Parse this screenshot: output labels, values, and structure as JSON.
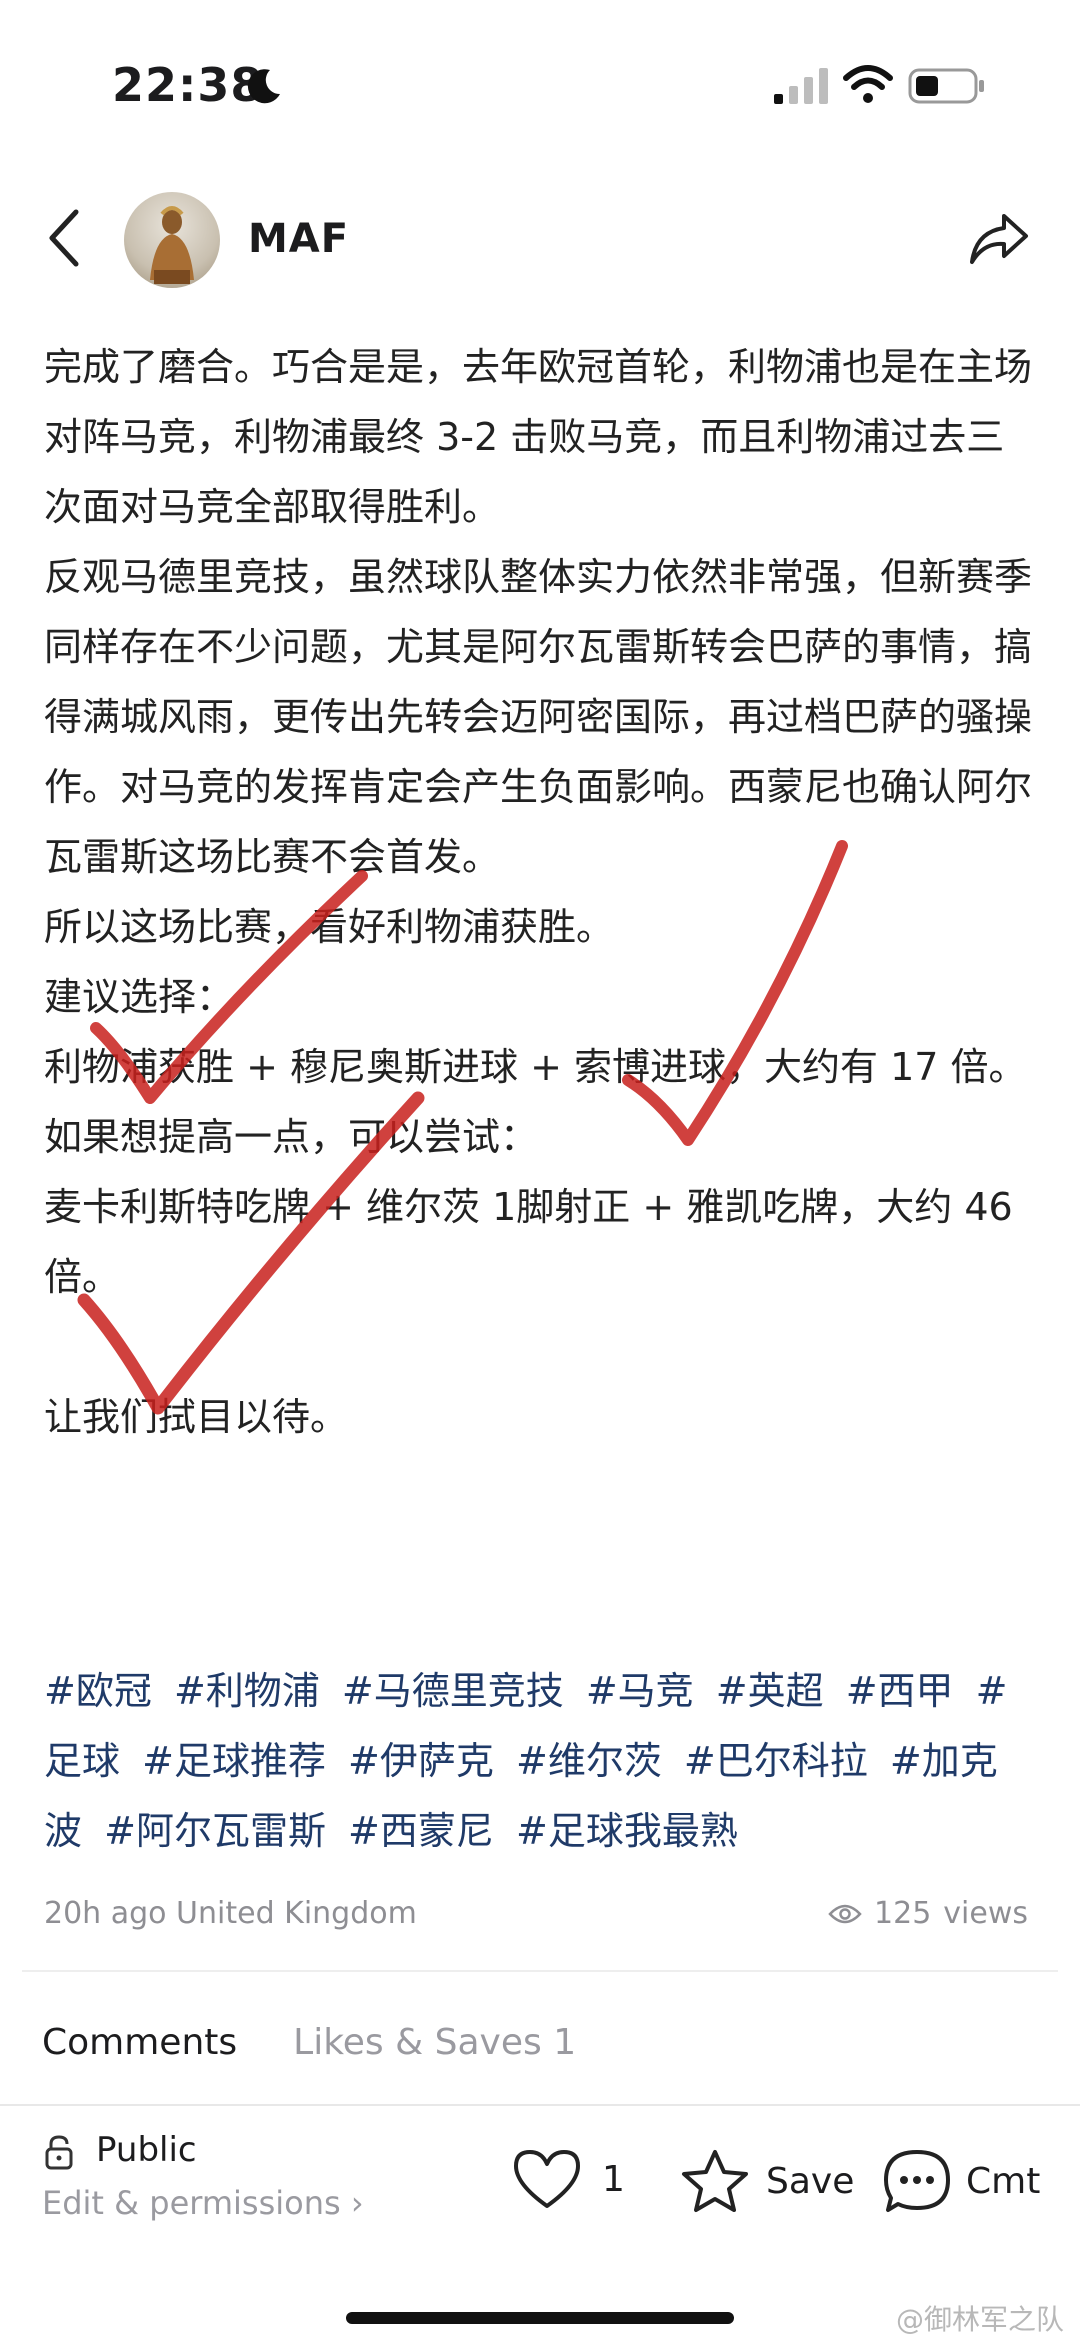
{
  "status_bar": {
    "time": "22:38"
  },
  "header": {
    "username": "MAF"
  },
  "post": {
    "paragraphs": [
      "完成了磨合。巧合是是，去年欧冠首轮，利物浦也是在主场对阵马竞，利物浦最终 3-2 击败马竞，而且利物浦过去三次面对马竞全部取得胜利。",
      "反观马德里竞技，虽然球队整体实力依然非常强，但新赛季同样存在不少问题，尤其是阿尔瓦雷斯转会巴萨的事情，搞得满城风雨，更传出先转会迈阿密国际，再过档巴萨的骚操作。对马竞的发挥肯定会产生负面影响。西蒙尼也确认阿尔瓦雷斯这场比赛不会首发。",
      "所以这场比赛，看好利物浦获胜。",
      "建议选择：",
      "利物浦获胜 + 穆尼奥斯进球 + 索博进球，大约有 17 倍。",
      "如果想提高一点，可以尝试：",
      "麦卡利斯特吃牌 + 维尔茨 1脚射正 + 雅凯吃牌，大约 46 倍。",
      "让我们拭目以待。"
    ],
    "tags": [
      "#欧冠",
      "#利物浦",
      "#马德里竞技",
      "#马竞",
      "#英超",
      "#西甲",
      "#足球",
      "#足球推荐",
      "#伊萨克",
      "#维尔茨",
      "#巴尔科拉",
      "#加克波",
      "#阿尔瓦雷斯",
      "#西蒙尼",
      "#足球我最熟"
    ],
    "meta": "20h ago United Kingdom",
    "views_count": "125",
    "views_label": "views"
  },
  "tabs": {
    "comments": "Comments",
    "likes_saves": "Likes & Saves 1"
  },
  "bottom_bar": {
    "visibility": "Public",
    "edit_label": "Edit & permissions ›",
    "like_count": "1",
    "save_label": "Save",
    "comment_label": "Cmt"
  },
  "watermark": "@御林军之队",
  "colors": {
    "tag": "#1f3a68",
    "check_mark": "#c8201c",
    "muted": "#8e8e93"
  },
  "icons": [
    "moon-icon",
    "signal-icon",
    "wifi-icon",
    "battery-icon",
    "back-icon",
    "share-icon",
    "eye-icon",
    "lock-icon",
    "heart-icon",
    "star-icon",
    "comment-icon"
  ]
}
